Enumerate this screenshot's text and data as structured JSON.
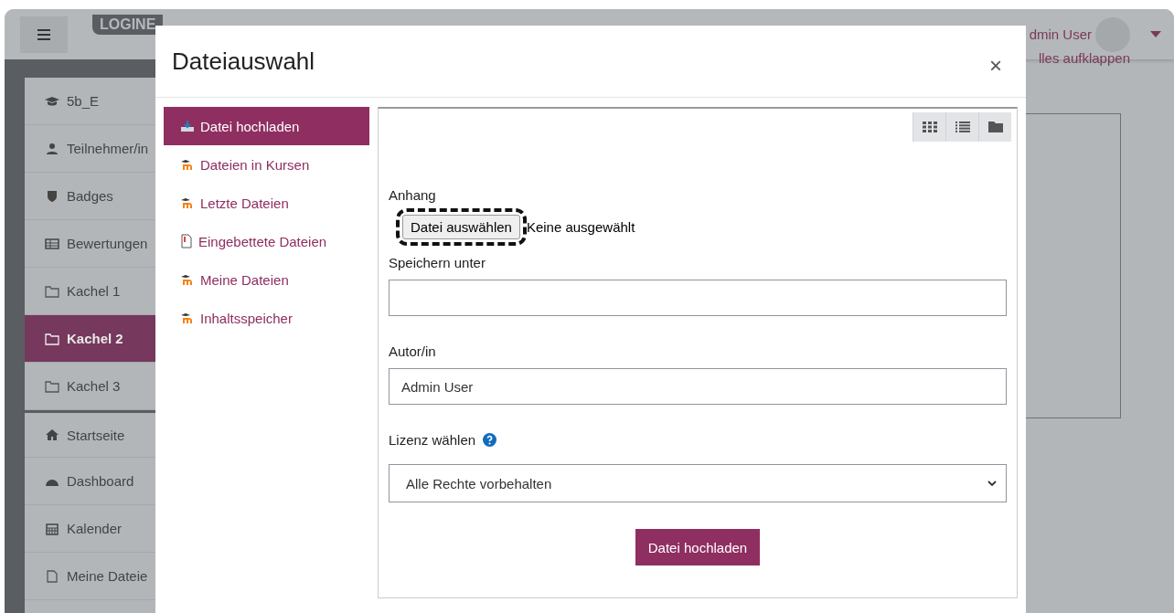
{
  "page": {
    "logo": "LOGINE",
    "user_name": "dmin User",
    "link_fragment": "lles aufklappen"
  },
  "nav": {
    "course": [
      {
        "label": "5b_E",
        "selected": false
      },
      {
        "label": "Teilnehmer/in",
        "selected": false
      },
      {
        "label": "Badges",
        "selected": false
      },
      {
        "label": "Bewertungen",
        "selected": false
      },
      {
        "label": "Kachel 1",
        "selected": false
      },
      {
        "label": "Kachel 2",
        "selected": true
      },
      {
        "label": "Kachel 3",
        "selected": false
      }
    ],
    "site": [
      {
        "label": "Startseite",
        "selected": false
      },
      {
        "label": "Dashboard",
        "selected": false
      },
      {
        "label": "Kalender",
        "selected": false
      },
      {
        "label": "Meine Dateie",
        "selected": false
      }
    ]
  },
  "dialog": {
    "title": "Dateiauswahl",
    "close": "×",
    "repositories": [
      {
        "label": "Datei hochladen",
        "selected": true
      },
      {
        "label": "Dateien in Kursen",
        "selected": false
      },
      {
        "label": "Letzte Dateien",
        "selected": false
      },
      {
        "label": "Eingebettete Dateien",
        "selected": false
      },
      {
        "label": "Meine Dateien",
        "selected": false
      },
      {
        "label": "Inhaltsspeicher",
        "selected": false
      }
    ],
    "view_buttons": [
      {
        "selected": false
      },
      {
        "selected": false
      },
      {
        "selected": false
      }
    ],
    "form": {
      "attachment_label": "Anhang",
      "choose_button": "Datei auswählen",
      "no_file": "Keine ausgewählt",
      "choose_focused": true,
      "save_as_label": "Speichern unter",
      "author_label": "Autor/in",
      "author_value": "Admin User",
      "license_label": "Lizenz wählen",
      "license_value": "Alle Rechte vorbehalten",
      "submit": "Datei hochladen"
    }
  }
}
